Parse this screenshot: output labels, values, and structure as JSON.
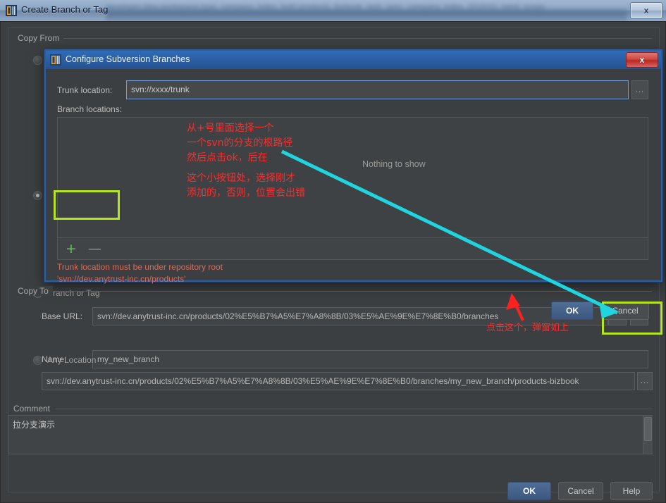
{
  "window": {
    "title": "Create Branch or Tag",
    "close_label": "x",
    "background_blurred_text": "developer.idea.workspace.type, company, index, both products, bizbook, task, sync, company, index, 2015/10, need, scope"
  },
  "copy_from": {
    "group_label": "Copy From",
    "options": [
      {
        "label": "",
        "selected": false
      },
      {
        "label": "",
        "selected": true
      }
    ]
  },
  "copy_to": {
    "group_label": "Copy To",
    "branch_or_tag": {
      "radio_label": "Branch or Tag",
      "selected": true,
      "base_url_label": "Base URL:",
      "base_url_value": "svn://dev.anytrust-inc.cn/products/02%E5%B7%A5%E7%A8%8B/03%E5%AE%9E%E7%8E%B0/branches",
      "name_label": "Name:",
      "name_value": "my_new_branch",
      "dropdown_icon": "chevron-down-icon",
      "browse_label": "..."
    },
    "any_location": {
      "radio_label": "Any Location",
      "selected": false,
      "value": "svn://dev.anytrust-inc.cn/products/02%E5%B7%A5%E7%A8%8B/03%E5%AE%9E%E7%8E%B0/branches/my_new_branch/products-bizbook",
      "browse_label": "..."
    }
  },
  "comment": {
    "group_label": "Comment",
    "value": "拉分支演示"
  },
  "footer": {
    "ok": "OK",
    "cancel": "Cancel",
    "help": "Help"
  },
  "dialog": {
    "title": "Configure Subversion Branches",
    "close_label": "x",
    "trunk_label": "Trunk location:",
    "trunk_value": "svn://xxxx/trunk",
    "trunk_browse_label": "...",
    "branch_locations_label": "Branch locations:",
    "empty_text": "Nothing to show",
    "add_label": "+",
    "remove_label": "—",
    "error_line1": "Trunk location must be under repository root",
    "error_line2": "'svn://dev.anytrust-inc.cn/products'",
    "ok": "OK",
    "cancel": "Cancel"
  },
  "annotations": {
    "note1": "从+号里面选择一个\n一个svn的分支的根路径\n然后点击ok，后在",
    "note2": "这个小按钮处，选择刚才\n添加的，否则，位置会出错",
    "note3": "点击这个，弹窗如上",
    "highlight_color": "#b5e61d",
    "arrow_color": "#1fd6e0",
    "pointer_color": "#ff2020",
    "text_color": "#ff2b2b"
  }
}
